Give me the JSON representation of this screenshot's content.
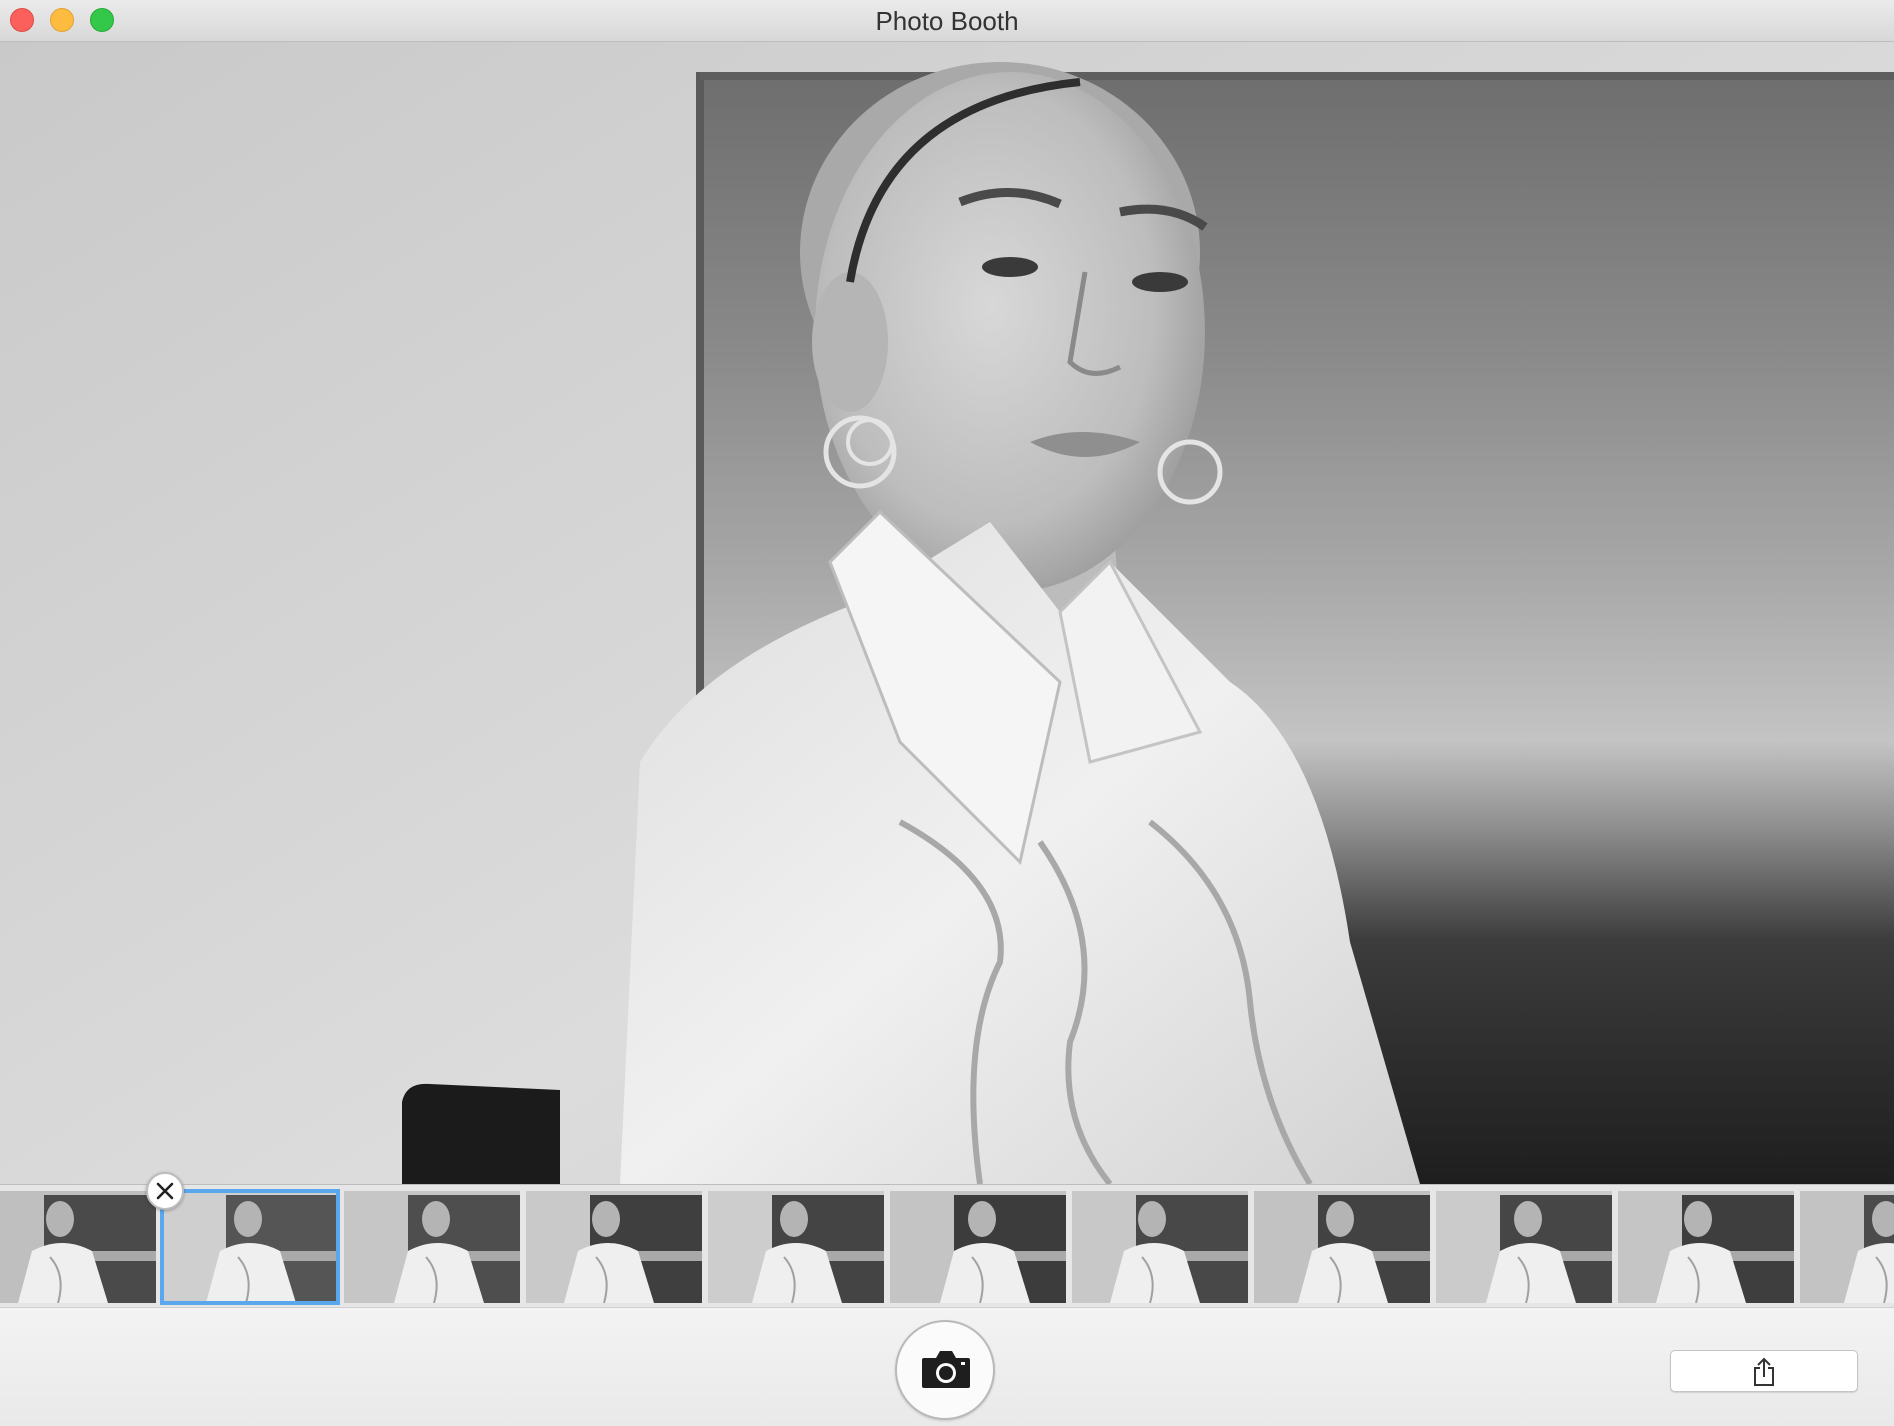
{
  "window": {
    "title": "Photo Booth"
  },
  "traffic_lights": {
    "close_color": "#fc605c",
    "minimize_color": "#fdbc40",
    "zoom_color": "#34c84a"
  },
  "filmstrip": {
    "thumbnail_count": 11,
    "selected_index": 1,
    "selection_color": "#5aa7ee"
  },
  "icons": {
    "take_photo": "camera-icon",
    "share": "share-icon",
    "delete": "close-icon"
  }
}
